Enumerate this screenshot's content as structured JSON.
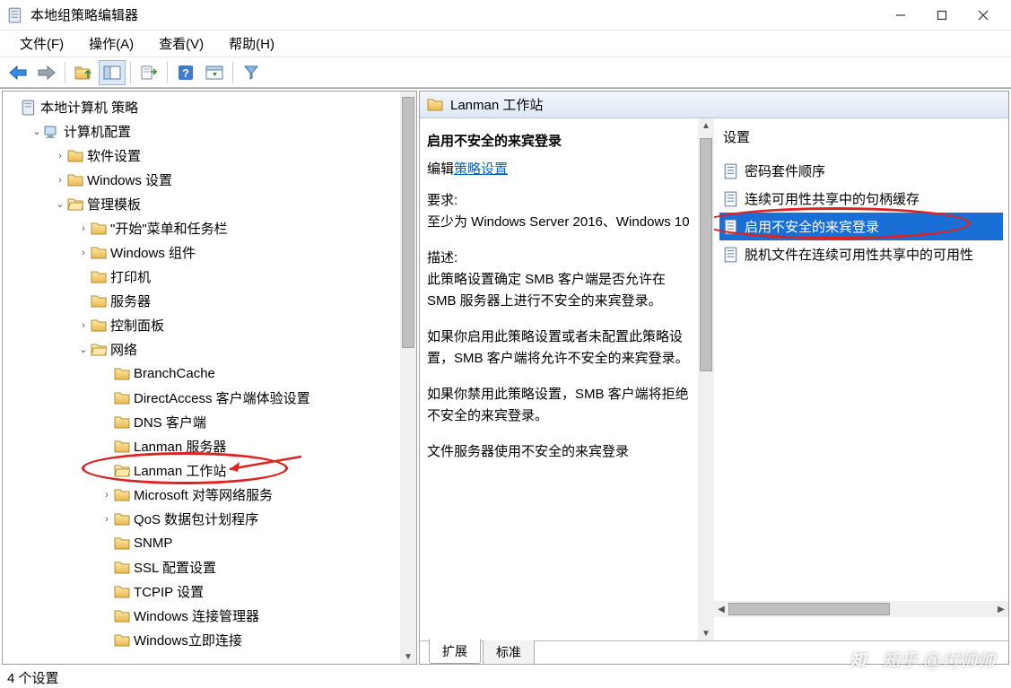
{
  "window": {
    "title": "本地组策略编辑器"
  },
  "menu": {
    "file": "文件(F)",
    "action": "操作(A)",
    "view": "查看(V)",
    "help": "帮助(H)"
  },
  "tree": {
    "root": "本地计算机 策略",
    "computer_config": "计算机配置",
    "software_settings": "软件设置",
    "windows_settings": "Windows 设置",
    "admin_templates": "管理模板",
    "start_menu": "\"开始\"菜单和任务栏",
    "windows_components": "Windows 组件",
    "printers": "打印机",
    "servers": "服务器",
    "control_panel": "控制面板",
    "network": "网络",
    "branchcache": "BranchCache",
    "directaccess": "DirectAccess 客户端体验设置",
    "dns_client": "DNS 客户端",
    "lanman_server": "Lanman 服务器",
    "lanman_workstation": "Lanman 工作站",
    "ms_p2p": "Microsoft 对等网络服务",
    "qos": "QoS 数据包计划程序",
    "snmp": "SNMP",
    "ssl_config": "SSL 配置设置",
    "tcpip_settings": "TCPIP 设置",
    "win_conn_mgr": "Windows 连接管理器",
    "win_instant_connect": "Windows立即连接"
  },
  "right": {
    "header": "Lanman 工作站",
    "detail_title": "启用不安全的来宾登录",
    "edit_label": "编辑",
    "edit_link": "策略设置",
    "req_label": "要求:",
    "req_text": "至少为 Windows Server 2016、Windows 10",
    "desc_label": "描述:",
    "desc_p1": "此策略设置确定 SMB 客户端是否允许在 SMB 服务器上进行不安全的来宾登录。",
    "desc_p2": "如果你启用此策略设置或者未配置此策略设置，SMB 客户端将允许不安全的来宾登录。",
    "desc_p3": "如果你禁用此策略设置，SMB 客户端将拒绝不安全的来宾登录。",
    "desc_p4": "文件服务器使用不安全的来宾登录",
    "settings_header": "设置",
    "settings": {
      "s1": "密码套件顺序",
      "s2": "连续可用性共享中的句柄缓存",
      "s3": "启用不安全的来宾登录",
      "s4": "脱机文件在连续可用性共享中的可用性"
    },
    "tabs": {
      "extended": "扩展",
      "standard": "标准"
    }
  },
  "status": {
    "count": "4 个设置"
  },
  "watermark": "知乎 @付帅帅"
}
